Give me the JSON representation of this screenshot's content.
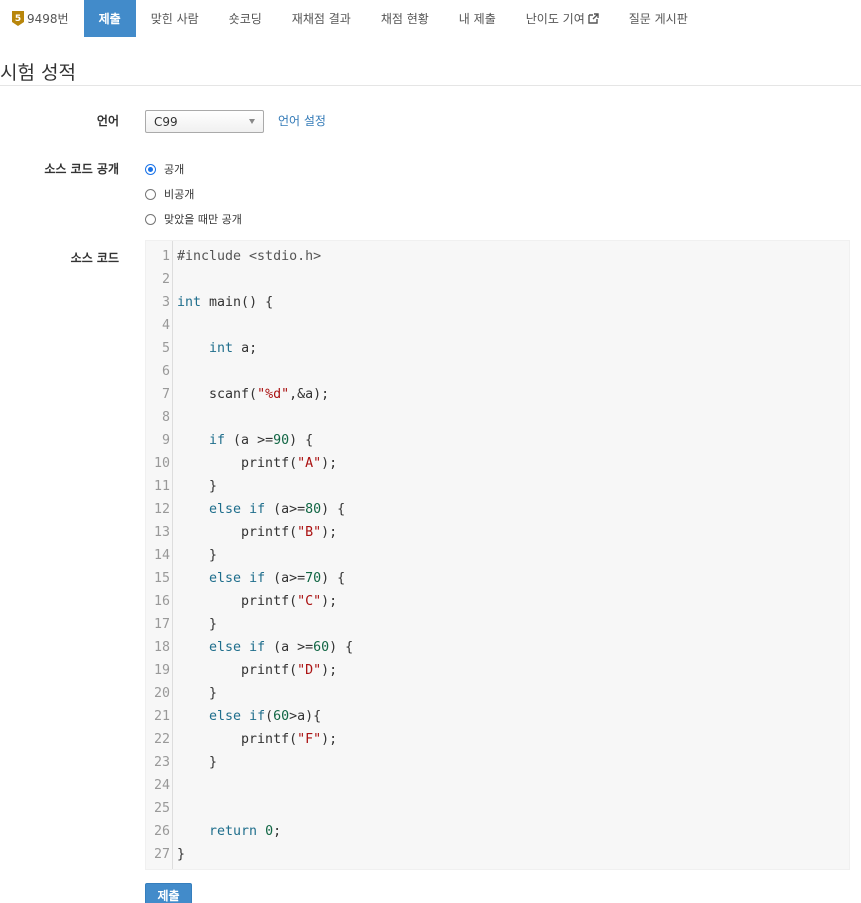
{
  "nav": {
    "problem_label": "9498번",
    "tier_icon": "tier-5-badge-icon",
    "tier_color": "#b8860b",
    "items": [
      {
        "label": "제출",
        "active": true
      },
      {
        "label": "맞힌 사람"
      },
      {
        "label": "숏코딩"
      },
      {
        "label": "재채점 결과"
      },
      {
        "label": "채점 현황"
      },
      {
        "label": "내 제출"
      },
      {
        "label": "난이도 기여",
        "external": true
      },
      {
        "label": "질문 게시판"
      }
    ]
  },
  "page": {
    "title": "시험 성적"
  },
  "form": {
    "language_label": "언어",
    "language_value": "C99",
    "language_setting_link": "언어 설정",
    "visibility_label": "소스 코드 공개",
    "visibility_options": [
      {
        "label": "공개",
        "checked": true
      },
      {
        "label": "비공개",
        "checked": false
      },
      {
        "label": "맞았을 때만 공개",
        "checked": false
      }
    ],
    "source_label": "소스 코드",
    "submit_label": "제출"
  },
  "code": {
    "lines": [
      "#include <stdio.h>",
      "",
      "int main() {",
      "",
      "    int a;",
      "",
      "    scanf(\"%d\",&a);",
      "",
      "    if (a >=90) {",
      "        printf(\"A\");",
      "    }",
      "    else if (a>=80) {",
      "        printf(\"B\");",
      "    }",
      "    else if (a>=70) {",
      "        printf(\"C\");",
      "    }",
      "    else if (a >=60) {",
      "        printf(\"D\");",
      "    }",
      "    else if(60>a){",
      "        printf(\"F\");",
      "    }",
      "",
      "",
      "    return 0;",
      "}"
    ]
  },
  "colors": {
    "accent": "#428bca",
    "link": "#337ab7"
  }
}
